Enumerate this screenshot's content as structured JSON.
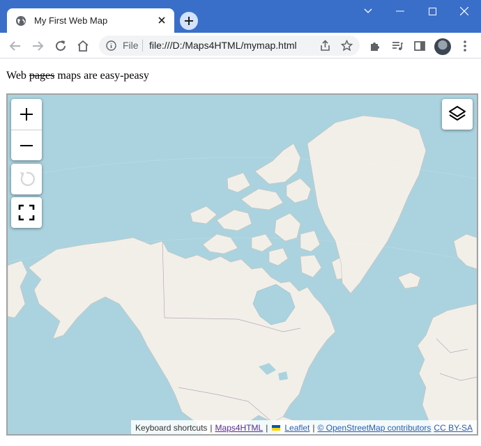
{
  "window": {
    "tab_title": "My First Web Map",
    "icons": {
      "favicon": "globe-icon",
      "close": "close-icon",
      "new_tab": "plus-icon"
    },
    "controls": [
      "chevron-down-icon",
      "minimize-icon",
      "maximize-icon",
      "close-window-icon"
    ]
  },
  "toolbar": {
    "address_scheme": "File",
    "address_url": "file:///D:/Maps4HTML/mymap.html",
    "icons": [
      "back-icon",
      "forward-icon",
      "reload-icon",
      "home-icon",
      "info-icon",
      "share-icon",
      "star-icon",
      "extensions-icon",
      "media-icon",
      "sidepanel-icon",
      "avatar",
      "menu-icon"
    ]
  },
  "page": {
    "heading_before": "Web",
    "heading_struck": "pages",
    "heading_after": "maps are easy-peasy"
  },
  "map": {
    "controls": {
      "zoom_in": "+",
      "zoom_out": "–",
      "icons": [
        "zoom-in-icon",
        "zoom-out-icon",
        "reload-map-icon",
        "fullscreen-icon",
        "layers-icon"
      ]
    },
    "attribution": {
      "keyboard": "Keyboard shortcuts",
      "sep": "|",
      "maps4html": "Maps4HTML",
      "leaflet": "Leaflet",
      "osm": "© OpenStreetMap contributors",
      "license": "CC BY-SA"
    },
    "colors": {
      "water": "#aad3df",
      "land": "#f2efe9",
      "border": "#a3a3a3"
    }
  }
}
